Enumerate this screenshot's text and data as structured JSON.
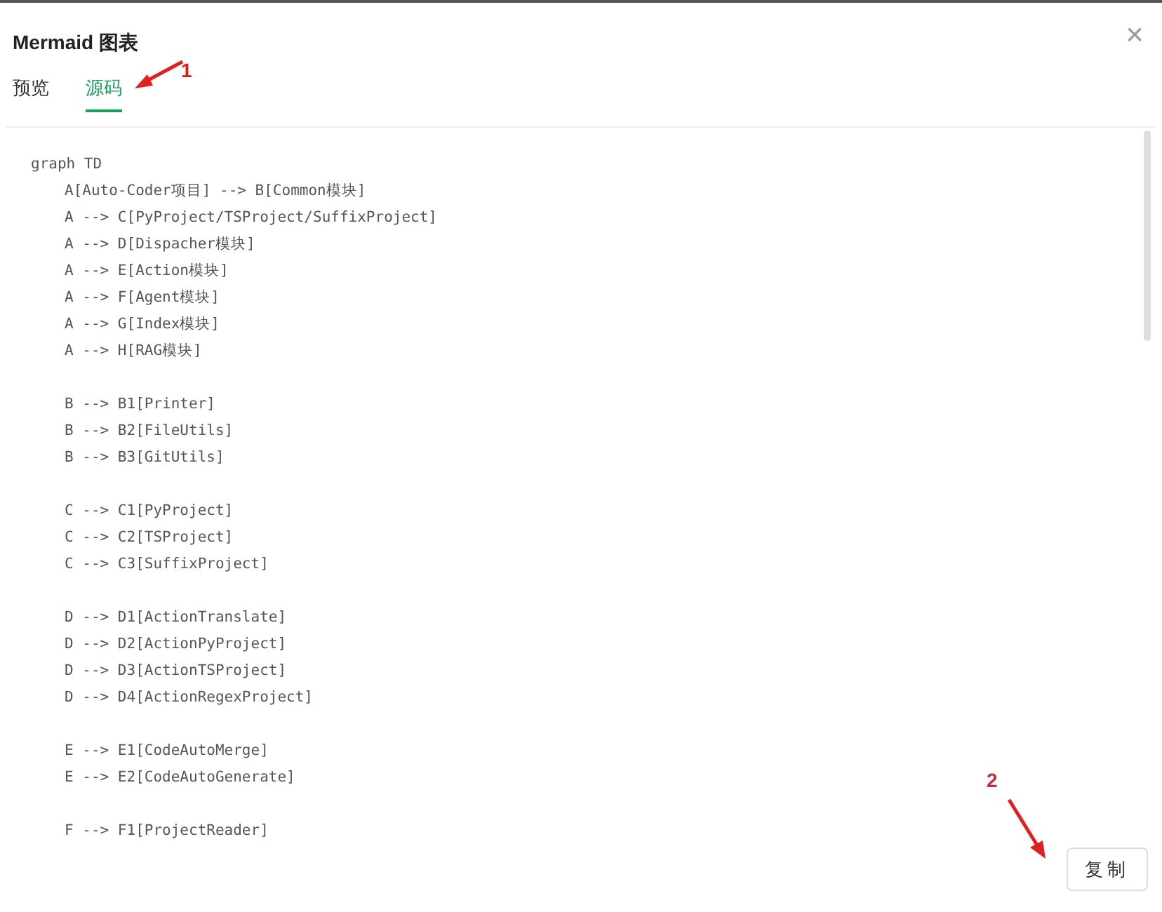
{
  "dialog": {
    "title": "Mermaid 图表",
    "close": "×"
  },
  "tabs": [
    {
      "label": "预览",
      "selected": false
    },
    {
      "label": "源码",
      "selected": true
    }
  ],
  "code": {
    "header": "graph TD",
    "blocks": [
      [
        "A[Auto-Coder项目] --> B[Common模块]",
        "A --> C[PyProject/TSProject/SuffixProject]",
        "A --> D[Dispacher模块]",
        "A --> E[Action模块]",
        "A --> F[Agent模块]",
        "A --> G[Index模块]",
        "A --> H[RAG模块]"
      ],
      [
        "B --> B1[Printer]",
        "B --> B2[FileUtils]",
        "B --> B3[GitUtils]"
      ],
      [
        "C --> C1[PyProject]",
        "C --> C2[TSProject]",
        "C --> C3[SuffixProject]"
      ],
      [
        "D --> D1[ActionTranslate]",
        "D --> D2[ActionPyProject]",
        "D --> D3[ActionTSProject]",
        "D --> D4[ActionRegexProject]"
      ],
      [
        "E --> E1[CodeAutoMerge]",
        "E --> E2[CodeAutoGenerate]"
      ],
      [
        "F --> F1[ProjectReader]"
      ]
    ]
  },
  "copy_button": "复制",
  "annotations": [
    {
      "label": "1"
    },
    {
      "label": "2"
    }
  ]
}
